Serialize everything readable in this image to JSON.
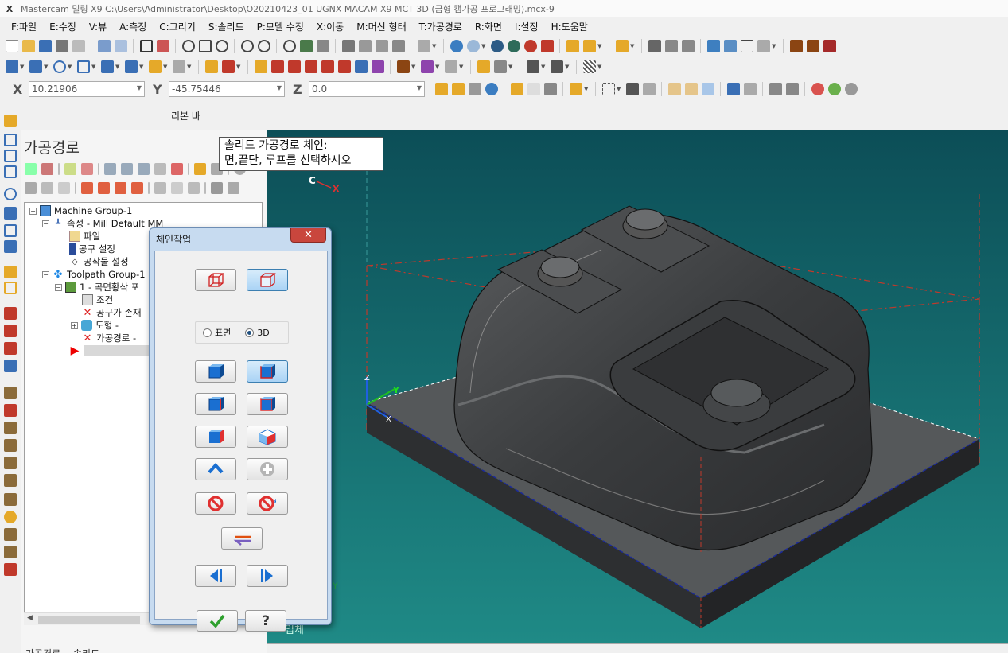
{
  "window": {
    "title": "Mastercam 밀링 X9  C:\\Users\\Administrator\\Desktop\\O20210423_01 UGNX MACAM X9 MCT 3D (금형 캠가공 프로그래밍).mcx-9"
  },
  "menu": [
    "F:파일",
    "E:수정",
    "V:뷰",
    "A:측정",
    "C:그리기",
    "S:솔리드",
    "P:모델 수정",
    "X:이동",
    "M:머신 형태",
    "T:가공경로",
    "R:화면",
    "I:설정",
    "H:도움말"
  ],
  "coords": {
    "x_label": "X",
    "x_value": "10.21906",
    "y_label": "Y",
    "y_value": "-45.75446",
    "z_label": "Z",
    "z_value": "0.0"
  },
  "ribbon_label": "리본 바",
  "toolpath_panel": {
    "title": "가공경로",
    "tree": [
      {
        "label": "Machine Group-1"
      },
      {
        "label": "속성 - Mill Default MM"
      },
      {
        "label": "파일"
      },
      {
        "label": "공구 설정"
      },
      {
        "label": "공작물 설정"
      },
      {
        "label": "Toolpath Group-1"
      },
      {
        "label": "1 - 곡면황삭 포"
      },
      {
        "label": "조건"
      },
      {
        "label": "공구가 존재"
      },
      {
        "label": "도형 -"
      },
      {
        "label": "가공경로 -"
      }
    ],
    "bottom_tabs": [
      "가공경로",
      "솔리드"
    ]
  },
  "tooltip": {
    "line1": "솔리드 가공경로 체인:",
    "line2": "면,끝단, 루프를 선택하시오"
  },
  "dialog": {
    "title": "체인작업",
    "radio_surface": "표면",
    "radio_3d": "3D",
    "selected_mode": "3D"
  },
  "viewport": {
    "axis_c": "C",
    "axis_x": "X",
    "gnomon_z": "Z",
    "gnomon_y": "Y",
    "gnomon_x": "X",
    "bottom_y": "Y",
    "view_label": "입체",
    "colors": {
      "background_top": "#0c4e57",
      "background_bottom": "#1f8a86",
      "part": "#3b3d3f"
    }
  }
}
